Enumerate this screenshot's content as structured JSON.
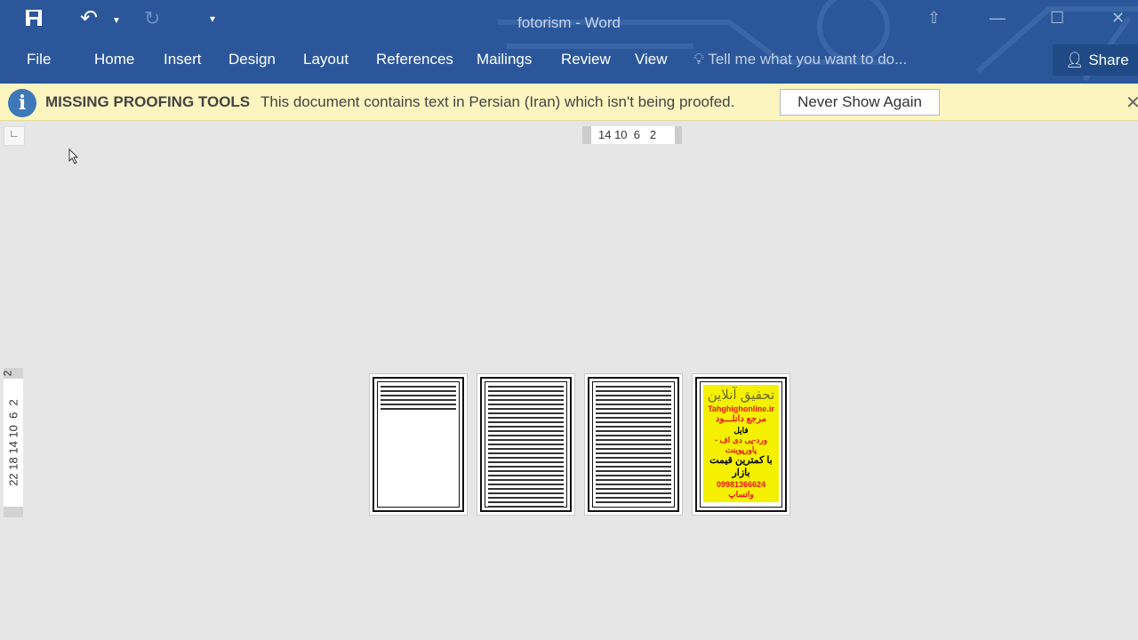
{
  "window": {
    "title": "fotorism - Word"
  },
  "quick_access": {
    "save": "save-icon",
    "undo": "undo-icon",
    "redo": "redo-icon",
    "customize": "▾"
  },
  "menu": [
    "File",
    "Home",
    "Insert",
    "Design",
    "Layout",
    "References",
    "Mailings",
    "Review",
    "View"
  ],
  "tell_me": {
    "placeholder": "Tell me what you want to do..."
  },
  "share": {
    "label": "Share"
  },
  "infobar": {
    "title": "MISSING PROOFING TOOLS",
    "message": "This document contains text in Persian (Iran) which isn't being proofed.",
    "button": "Never Show Again"
  },
  "ruler": {
    "horizontal": "14 10  6   2",
    "vertical": "22 18 14 10  6  2",
    "vertical_top": "2"
  },
  "pages": [
    {
      "kind": "text-short"
    },
    {
      "kind": "text-full"
    },
    {
      "kind": "text-full"
    },
    {
      "kind": "poster"
    }
  ],
  "poster": {
    "line1": "تحقیق آنلاین",
    "site": "Tahghighonline.ir",
    "line3": "مرجع دانلـــود",
    "line4": "فایل",
    "line5": "ورد-پی دی اف - پاورپوینت",
    "line6": "با کمترین قیمت بازار",
    "phone": "09981366624 واتساپ"
  },
  "colors": {
    "titlebar": "#2b579a",
    "infobar": "#fdf5c0",
    "poster_bg": "#f4f000",
    "poster_red": "#e8141a"
  }
}
